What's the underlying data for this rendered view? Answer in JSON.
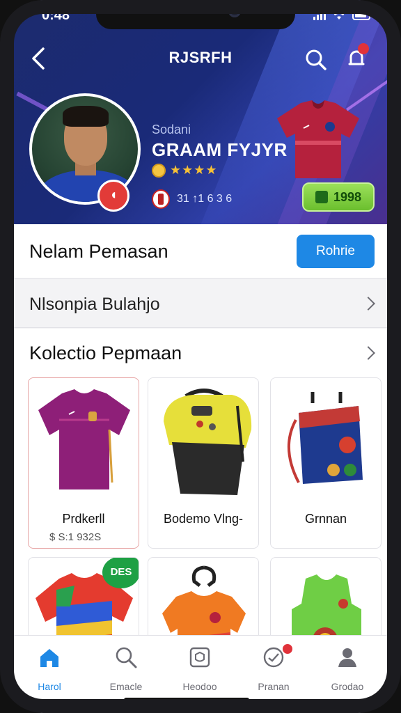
{
  "status": {
    "time": "0:48"
  },
  "header": {
    "title": "RJSRFH"
  },
  "player": {
    "subtitle": "Sodani",
    "name": "GRAAM FYJYR",
    "stars": "★★★★",
    "stats": "31 ↑1 6 3 6"
  },
  "price_button": {
    "label": "1998"
  },
  "section_main": {
    "title": "Nelam Pemasan",
    "button_label": "Rohrie"
  },
  "section_secondary": {
    "title": "Nlsonpia Bulahjo"
  },
  "collection": {
    "title": "Kolectio Pepmaan",
    "items": [
      {
        "name": "Prdkerll",
        "price": "$ S:1 932S"
      },
      {
        "name": "Bodemo Vlng-",
        "price": ""
      },
      {
        "name": "Grnnan",
        "price": ""
      }
    ],
    "row2_tag": "DES"
  },
  "tabs": [
    {
      "label": "Harol"
    },
    {
      "label": "Emacle"
    },
    {
      "label": "Heodoo"
    },
    {
      "label": "Pranan"
    },
    {
      "label": "Grodao"
    }
  ],
  "colors": {
    "accent": "#1e88e5",
    "hero": "#1c2b6e",
    "price_green": "#6bbf2e",
    "badge_red": "#e0323a"
  }
}
